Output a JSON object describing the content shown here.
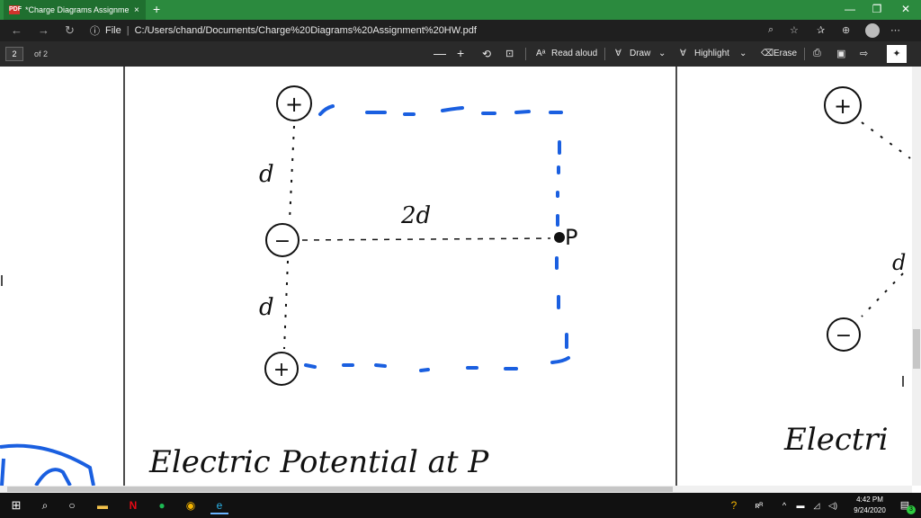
{
  "titlebar": {
    "tab_title": "*Charge Diagrams Assignment H",
    "tab_close": "×",
    "new_tab": "+",
    "pdf_badge": "PDF"
  },
  "address": {
    "info_symbol": "ⓘ",
    "scheme_label": "File",
    "url": "C:/Users/chand/Documents/Charge%20Diagrams%20Assignment%20HW.pdf"
  },
  "toolbar": {
    "page_number": "2",
    "page_total": "of 2",
    "read_aloud": "Read aloud",
    "draw": "Draw",
    "highlight": "Highlight",
    "erase": "Erase"
  },
  "document": {
    "left_diagram": {
      "label_d_top": "d",
      "label_d_bottom": "d",
      "label_2d": "2d",
      "label_p": "P",
      "charge_top": "+",
      "charge_middle": "−",
      "charge_bottom": "+",
      "caption": "Electric Potential at P"
    },
    "right_diagram": {
      "charge_top": "+",
      "charge_bottom": "−",
      "label_d": "d",
      "caption_partial": "Electri"
    }
  },
  "taskbar": {
    "time": "4:42 PM",
    "date": "9/24/2020",
    "notification_count": "3"
  },
  "colors": {
    "titlebar": "#2b8a3e",
    "ink_blue": "#1a5fe0",
    "ink_black": "#111111"
  }
}
